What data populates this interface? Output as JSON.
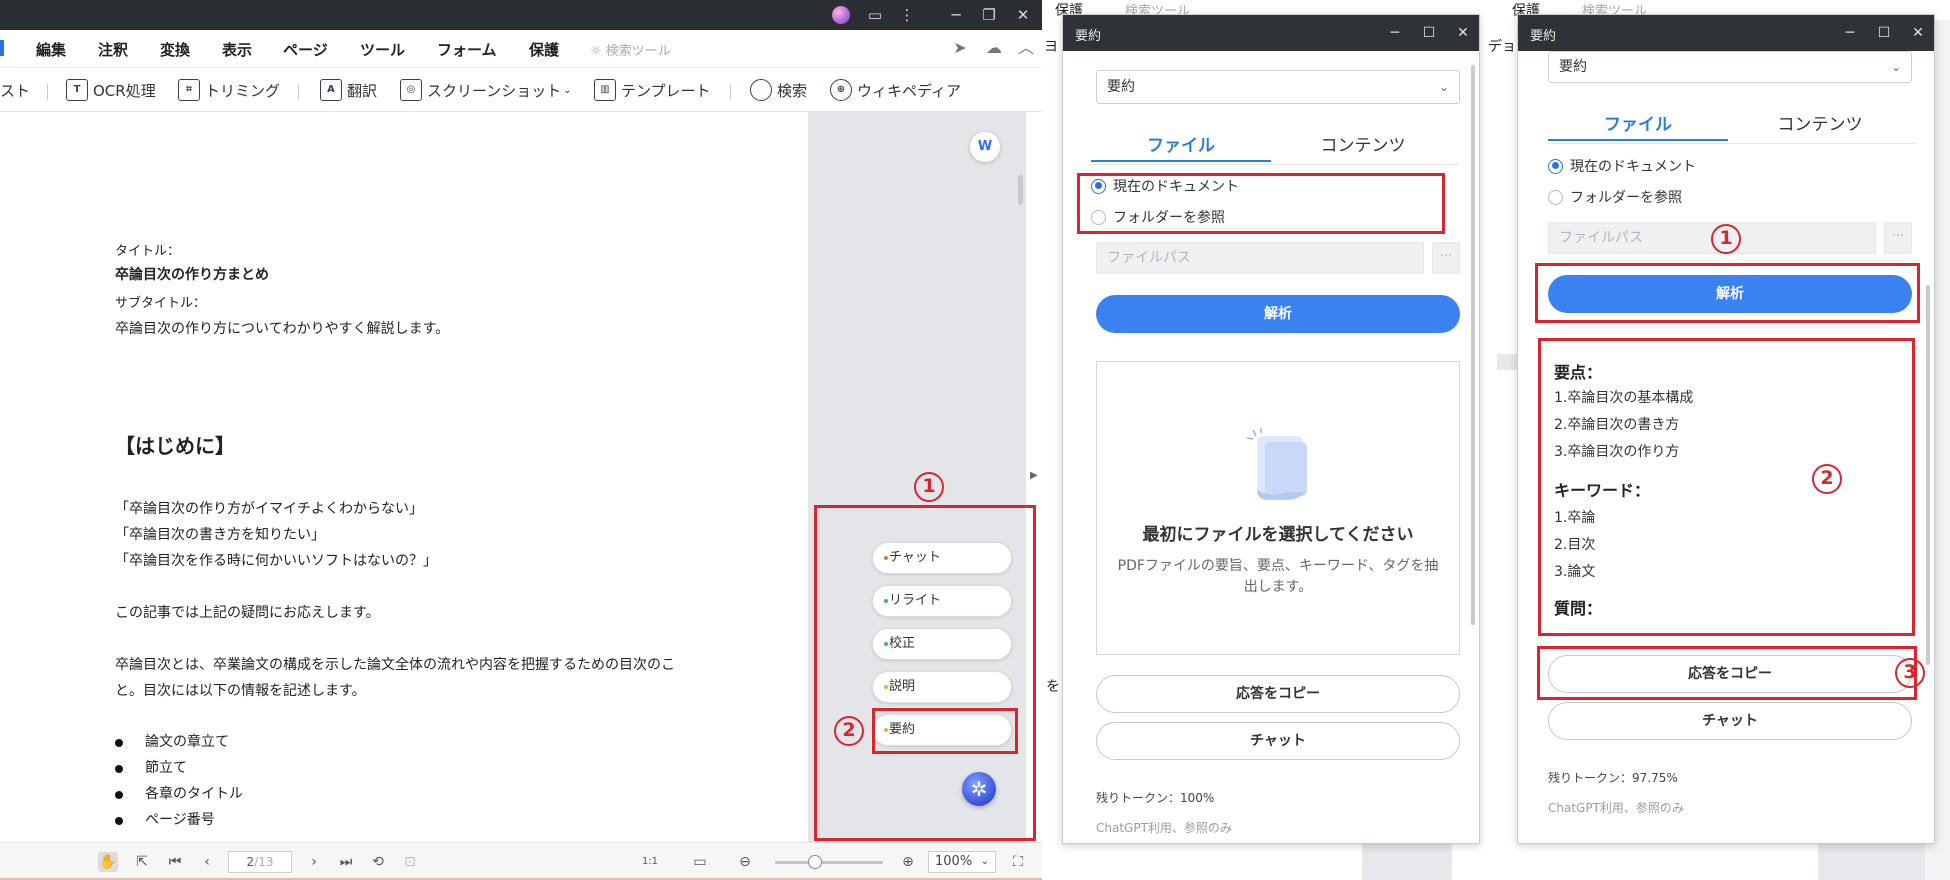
{
  "app": {
    "menu": [
      "編集",
      "注釈",
      "変換",
      "表示",
      "ページ",
      "ツール",
      "フォーム",
      "保護"
    ],
    "search_tool": "検索ツール",
    "toolbar": {
      "text_partial": "スト",
      "ocr": "OCR処理",
      "crop": "トリミング",
      "translate": "翻訳",
      "screenshot": "スクリーンショット",
      "template": "テンプレート",
      "search": "検索",
      "wikipedia": "ウィキペディア"
    },
    "document": {
      "title_label": "タイトル：",
      "title": "卒論目次の作り方まとめ",
      "subtitle_label": "サブタイトル：",
      "subtitle": "卒論目次の作り方についてわかりやすく解説します。",
      "heading": "【はじめに】",
      "quotes": [
        "「卒論目次の作り方がイマイチよくわからない」",
        "「卒論目次の書き方を知りたい」",
        "「卒論目次を作る時に何かいいソフトはないの？」"
      ],
      "intro": "この記事では上記の疑問にお応えします。",
      "para_1": "卒論目次とは、卒業論文の構成を示した論文全体の流れや内容を把握するための目次のこ",
      "para_2": "と。目次には以下の情報を記述します。",
      "bullets": [
        "論文の章立て",
        "節立て",
        "各章のタイトル",
        "ページ番号"
      ]
    },
    "ai_menu": [
      {
        "label": "チャット",
        "dot": "#e07a3a"
      },
      {
        "label": "リライト",
        "dot": "#4fb26b"
      },
      {
        "label": "校正",
        "dot": "#4fb26b"
      },
      {
        "label": "説明",
        "dot": "#e0b13a"
      },
      {
        "label": "要約",
        "dot": "#e0b13a"
      }
    ],
    "word_badge": "W",
    "status": {
      "page": "2",
      "total": "/13",
      "zoom": "100%",
      "one_to_one": "1:1"
    }
  },
  "annotations": {
    "n1": "1",
    "n2": "2",
    "n3": "3"
  },
  "behind": {
    "protect": "保護",
    "search_tool": "検索ツール",
    "de": "デョ",
    "yo": "ヨ",
    "wo": "を"
  },
  "panel_a": {
    "title": "要約",
    "select": "要約",
    "tab_file": "ファイル",
    "tab_content": "コンテンツ",
    "radio_current": "現在のドキュメント",
    "radio_folder": "フォルダーを参照",
    "path_placeholder": "ファイルパス",
    "more": "···",
    "analyze": "解析",
    "empty_title": "最初にファイルを選択してください",
    "empty_sub": "PDFファイルの要旨、要点、キーワード、タグを抽出します。",
    "copy": "応答をコピー",
    "chat": "チャット",
    "tokens": "残りトークン：100%",
    "note": "ChatGPT利用、参照のみ"
  },
  "panel_b": {
    "title": "要約",
    "select": "要約",
    "tab_file": "ファイル",
    "tab_content": "コンテンツ",
    "radio_current": "現在のドキュメント",
    "radio_folder": "フォルダーを参照",
    "path_placeholder": "ファイルパス",
    "more": "···",
    "analyze": "解析",
    "points_head": "要点：",
    "points": [
      "1.卒論目次の基本構成",
      "2.卒論目次の書き方",
      "3.卒論目次の作り方"
    ],
    "keywords_head": "キーワード：",
    "keywords": [
      "1.卒論",
      "2.目次",
      "3.論文"
    ],
    "questions_head": "質問：",
    "copy": "応答をコピー",
    "chat": "チャット",
    "tokens": "残りトークン：97.75%",
    "note": "ChatGPT利用、参照のみ"
  },
  "colors": {
    "accent": "#3b82f1",
    "annotation": "#d7262e",
    "titlebar": "#2b2e33"
  }
}
